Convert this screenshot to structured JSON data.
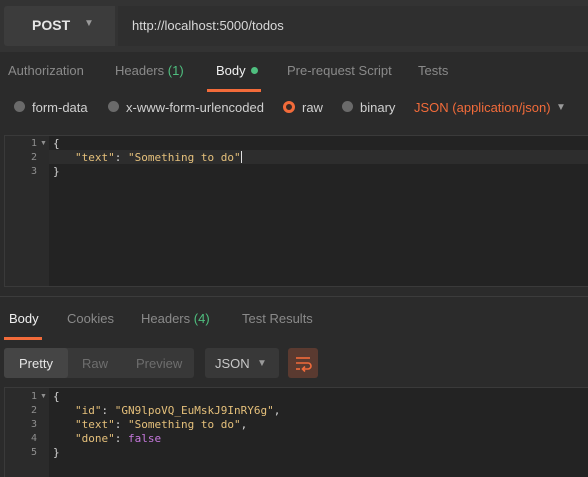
{
  "request": {
    "method": "POST",
    "url": "http://localhost:5000/todos"
  },
  "request_tabs": {
    "authorization": "Authorization",
    "headers": "Headers",
    "headers_count": "(1)",
    "body": "Body",
    "prerequest": "Pre-request Script",
    "tests": "Tests"
  },
  "body_types": {
    "form_data": "form-data",
    "urlencoded": "x-www-form-urlencoded",
    "raw": "raw",
    "binary": "binary",
    "selected": "raw",
    "content_type": "JSON (application/json)"
  },
  "request_editor": {
    "line_numbers": [
      "1",
      "2",
      "3"
    ],
    "lines": {
      "l1": "{",
      "l2_key": "\"text\"",
      "l2_colon": ": ",
      "l2_value": "\"Something to do\"",
      "l3": "}"
    }
  },
  "response_tabs": {
    "body": "Body",
    "cookies": "Cookies",
    "headers": "Headers",
    "headers_count": "(4)",
    "test_results": "Test Results"
  },
  "response_view": {
    "pretty": "Pretty",
    "raw": "Raw",
    "preview": "Preview",
    "format": "JSON"
  },
  "response_editor": {
    "line_numbers": [
      "1",
      "2",
      "3",
      "4",
      "5"
    ],
    "lines": {
      "l1": "{",
      "l2_key": "\"id\"",
      "l2_value": "\"GN9lpoVQ_EuMskJ9InRY6g\"",
      "l3_key": "\"text\"",
      "l3_value": "\"Something to do\"",
      "l4_key": "\"done\"",
      "l4_value": "false",
      "l5": "}",
      "colon": ": ",
      "comma": ","
    }
  },
  "colors": {
    "accent": "#f26b3a",
    "count_green": "#4fbf7f",
    "background": "#2b2b2b"
  },
  "icons": {
    "method_dropdown": "chevron-down-icon",
    "content_type_dropdown": "chevron-down-icon",
    "format_dropdown": "chevron-down-icon",
    "wrap": "wrap-lines-icon",
    "fold": "fold-triangle-icon"
  }
}
